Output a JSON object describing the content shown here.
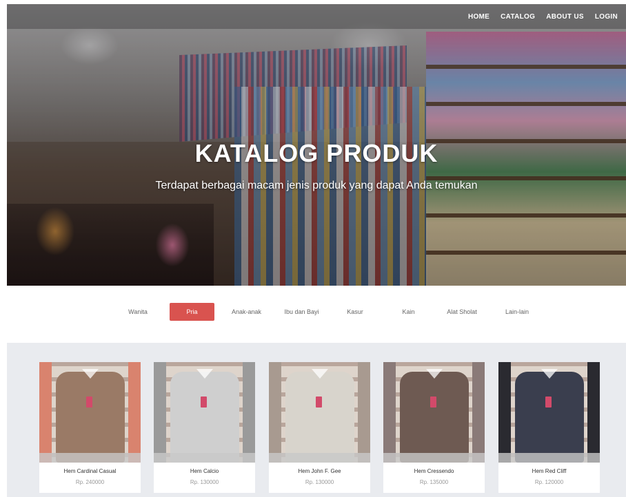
{
  "nav": {
    "links": [
      "HOME",
      "CATALOG",
      "ABOUT US",
      "LOGIN"
    ]
  },
  "hero": {
    "title": "KATALOG PRODUK",
    "subtitle": "Terdapat berbagai macam jenis produk yang dapat Anda temukan"
  },
  "categories": {
    "items": [
      "Wanita",
      "Pria",
      "Anak-anak",
      "Ibu dan Bayi",
      "Kasur",
      "Kain",
      "Alat Sholat",
      "Lain-lain"
    ],
    "active": "Pria",
    "active_color": "#d9534f"
  },
  "products": [
    {
      "name": "Hem Cardinal Casual",
      "price": "Rp. 240000",
      "color": "#9a7a66",
      "accent": "#d9836e"
    },
    {
      "name": "Hem Calcio",
      "price": "Rp. 130000",
      "color": "#cfcfcf",
      "accent": "#9a9a9a"
    },
    {
      "name": "Hem John F. Gee",
      "price": "Rp. 130000",
      "color": "#d8d4cc",
      "accent": "#a89a90"
    },
    {
      "name": "Hem Cressendo",
      "price": "Rp. 135000",
      "color": "#6e5a52",
      "accent": "#8a7a78"
    },
    {
      "name": "Hem Red Cliff",
      "price": "Rp. 120000",
      "color": "#3a3e4e",
      "accent": "#2a2a30"
    }
  ]
}
